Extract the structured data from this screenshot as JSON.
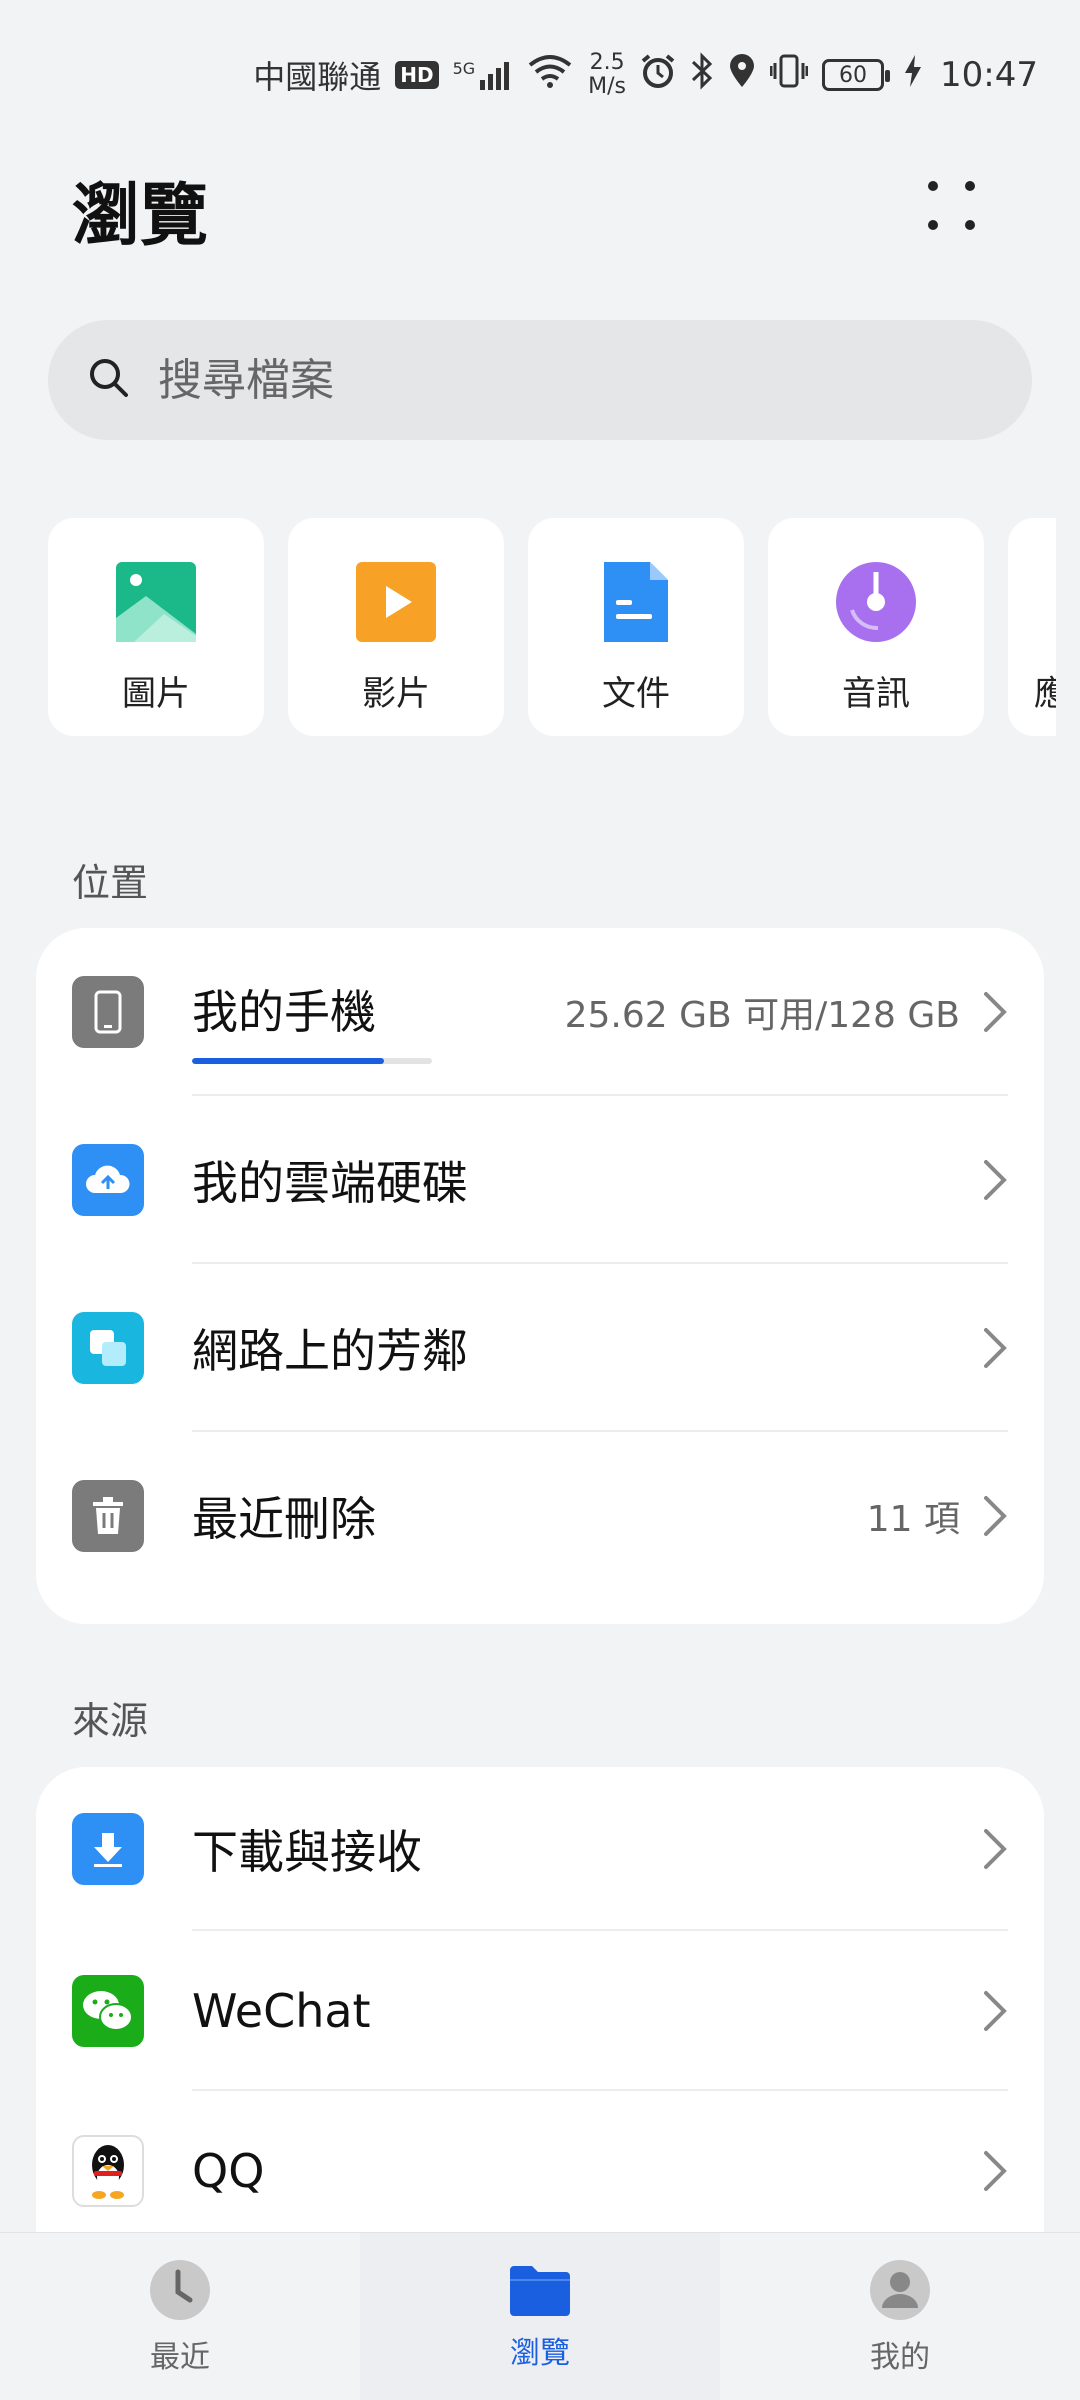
{
  "status_bar": {
    "carrier": "中國聯通",
    "hd": "HD",
    "network": "5G",
    "speed_value": "2.5",
    "speed_unit": "M/s",
    "battery": "60",
    "time": "10:47"
  },
  "header": {
    "title": "瀏覽"
  },
  "search": {
    "placeholder": "搜尋檔案"
  },
  "categories": [
    {
      "label": "圖片",
      "icon": "image-icon",
      "color": "#1bb889"
    },
    {
      "label": "影片",
      "icon": "video-icon",
      "color": "#f7a127"
    },
    {
      "label": "文件",
      "icon": "document-icon",
      "color": "#2e8ff5"
    },
    {
      "label": "音訊",
      "icon": "audio-icon",
      "color": "#a870ef"
    },
    {
      "label": "應",
      "icon": "apps-icon",
      "color": "#888888"
    }
  ],
  "locations": {
    "section_label": "位置",
    "items": [
      {
        "label": "我的手機",
        "value": "25.62 GB 可用/128 GB",
        "icon": "phone-icon",
        "storage_used_fraction": 0.8
      },
      {
        "label": "我的雲端硬碟",
        "value": "",
        "icon": "cloud-drive-icon"
      },
      {
        "label": "網路上的芳鄰",
        "value": "",
        "icon": "network-neighborhood-icon"
      },
      {
        "label": "最近刪除",
        "value": "11 項",
        "icon": "trash-icon"
      }
    ]
  },
  "sources": {
    "section_label": "來源",
    "items": [
      {
        "label": "下載與接收",
        "icon": "download-icon"
      },
      {
        "label": "WeChat",
        "icon": "wechat-icon"
      },
      {
        "label": "QQ",
        "icon": "qq-icon"
      }
    ]
  },
  "bottom_nav": [
    {
      "label": "最近",
      "icon": "clock-icon",
      "active": false
    },
    {
      "label": "瀏覽",
      "icon": "folder-icon",
      "active": true
    },
    {
      "label": "我的",
      "icon": "profile-icon",
      "active": false
    }
  ],
  "colors": {
    "accent": "#1a5fe0",
    "background": "#f1f3f5"
  }
}
